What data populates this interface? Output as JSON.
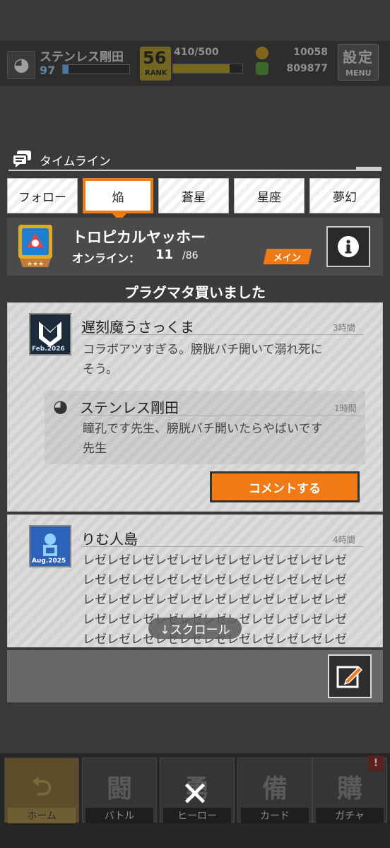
{
  "player": {
    "name": "ステンレス剛田",
    "level": "97",
    "rank": "56",
    "rank_label": "RANK",
    "stamina": "410/500",
    "currency1": "10058",
    "currency2": "809877",
    "settings_label": "設定",
    "menu_label": "MENU"
  },
  "timeline": {
    "title": "タイムライン"
  },
  "tabs": [
    {
      "label": "フォロー"
    },
    {
      "label": "焔"
    },
    {
      "label": "蒼星"
    },
    {
      "label": "星座"
    },
    {
      "label": "夢幻"
    }
  ],
  "group": {
    "name": "トロピカルヤッホー",
    "online_label": "オンライン：",
    "online_count": "11",
    "online_total": "/86",
    "badge": "メイン",
    "status": "プラグマタ買いました"
  },
  "posts": [
    {
      "author": "遅刻魔うさっくま",
      "time": "3時間",
      "avatar_caption": "Feb.2026",
      "body_line1": "コラボアツすぎる。膀胱バチ開いて溺れ死に",
      "body_line2": "そう。",
      "reply": {
        "author": "ステンレス剛田",
        "time": "1時間",
        "body_line1": "瞳孔です先生、膀胱バチ開いたらやばいです",
        "body_line2": "先生"
      },
      "comment_button": "コメントする"
    },
    {
      "author": "りむ人島",
      "time": "4時間",
      "avatar_caption": "Aug.2025",
      "body_lines": [
        "レゼレゼレゼレゼレゼレゼレゼレゼレゼレゼレゼ",
        "レゼレゼレゼレゼレゼレゼレゼレゼレゼレゼレゼ",
        "レゼレゼレゼレゼレゼレゼレゼレゼレゼレゼレゼ",
        "レゼレゼレゼレゼレゼレゼレゼレゼレゼレゼレゼ",
        "レゼレゼレゼレゼレゼレゼレゼレゼレゼレゼレゼ"
      ]
    }
  ],
  "scroll_hint": "↓スクロール",
  "nav": [
    {
      "label": "ホーム",
      "glyph": "⮌"
    },
    {
      "label": "バトル",
      "glyph": "闘"
    },
    {
      "label": "ヒーロー",
      "glyph": "勇"
    },
    {
      "label": "カード",
      "glyph": "備"
    },
    {
      "label": "ガチャ",
      "glyph": "購"
    }
  ],
  "nav_alert": "!",
  "close_glyph": "✕",
  "colors": {
    "accent": "#f07a16",
    "panel_dark": "#4a4a4a",
    "background": "#3a3a3a"
  }
}
